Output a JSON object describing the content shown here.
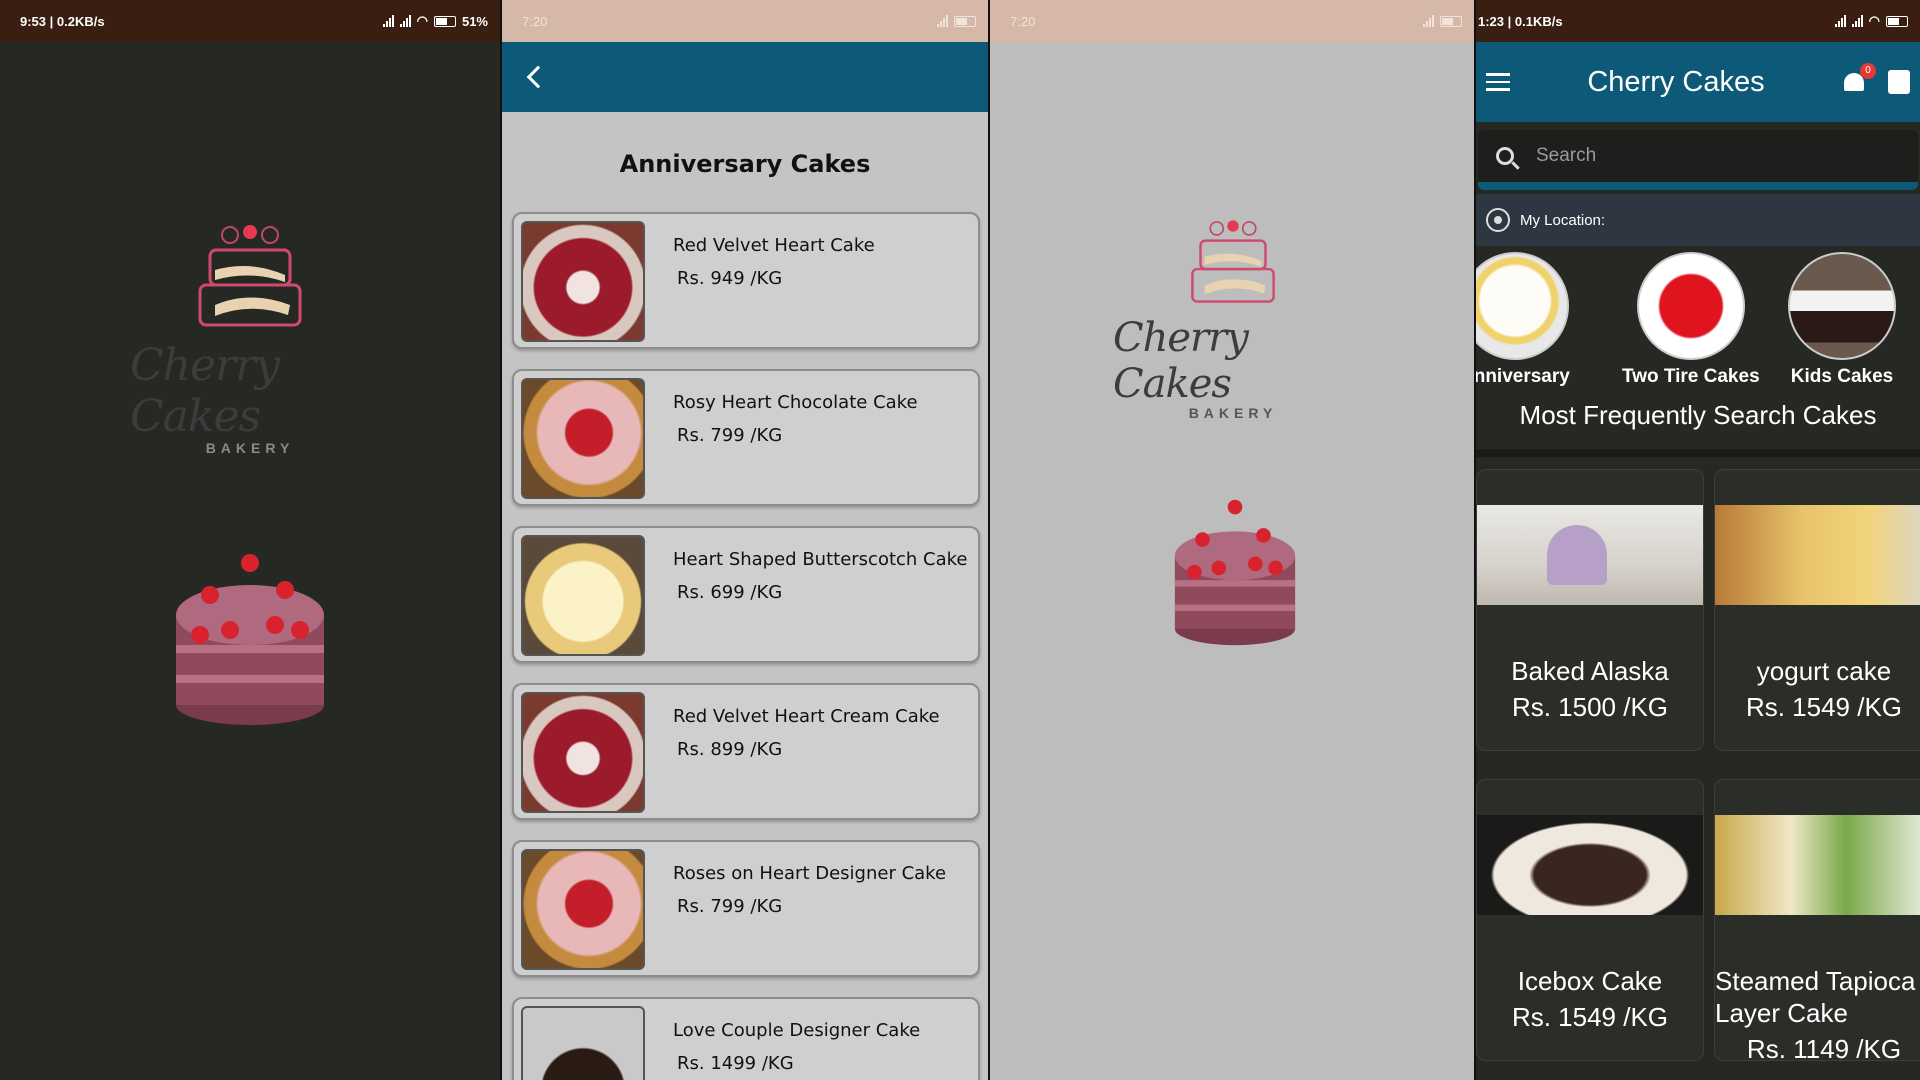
{
  "screen1": {
    "status": {
      "time": "9:53 | 0.2KB/s",
      "battery": "51%"
    },
    "logo": {
      "script": "Cherry Cakes",
      "sub": "BAKERY"
    }
  },
  "screen2": {
    "status": {
      "time": "7:20"
    },
    "title": "Anniversary Cakes",
    "products": [
      {
        "name": "Red Velvet Heart Cake",
        "price": "Rs. 949 /KG"
      },
      {
        "name": "Rosy Heart Chocolate Cake",
        "price": "Rs. 799 /KG"
      },
      {
        "name": "Heart Shaped Butterscotch Cake",
        "price": "Rs. 699 /KG"
      },
      {
        "name": "Red Velvet Heart Cream Cake",
        "price": "Rs. 899 /KG"
      },
      {
        "name": "Roses on Heart Designer Cake",
        "price": "Rs. 799 /KG"
      },
      {
        "name": "Love Couple Designer Cake",
        "price": "Rs. 1499 /KG"
      }
    ]
  },
  "screen3": {
    "status": {
      "time": "7:20"
    },
    "logo": {
      "script": "Cherry Cakes",
      "sub": "BAKERY"
    }
  },
  "screen4": {
    "status": {
      "time": "1:23 | 0.1KB/s"
    },
    "app_title": "Cherry Cakes",
    "notification_count": "0",
    "search": {
      "placeholder": "Search"
    },
    "location_label": "My Location:",
    "categories": [
      {
        "label": "Anniversary"
      },
      {
        "label": "Two Tire Cakes"
      },
      {
        "label": "Kids Cakes"
      }
    ],
    "section_title": "Most Frequently Search Cakes",
    "products": [
      {
        "name": "Baked Alaska",
        "price": "Rs. 1500 /KG"
      },
      {
        "name": "yogurt cake",
        "price": "Rs. 1549 /KG"
      },
      {
        "name": "Icebox Cake",
        "price": "Rs. 1549 /KG"
      },
      {
        "name": "Steamed Tapioca Layer Cake",
        "price": "Rs. 1149 /KG"
      }
    ]
  }
}
